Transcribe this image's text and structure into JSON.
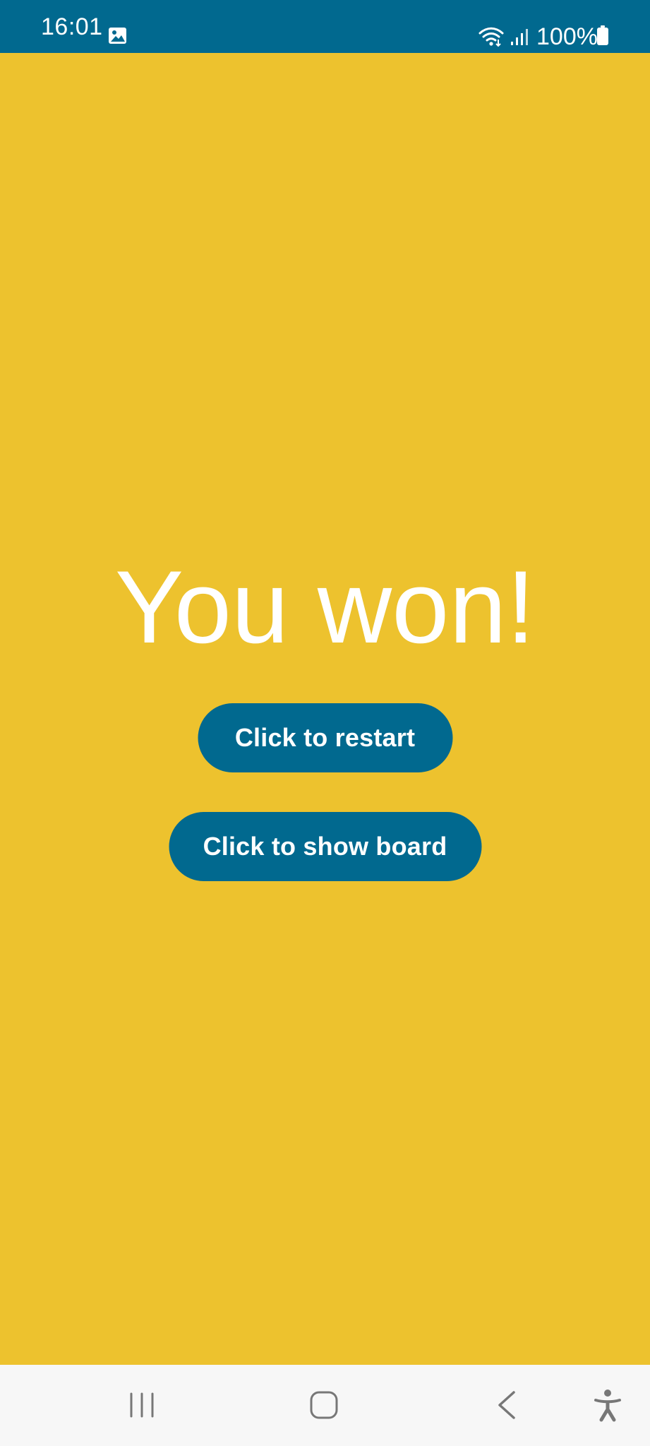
{
  "status_bar": {
    "time": "16:01",
    "battery": "100%",
    "icons": {
      "gallery": "gallery-icon",
      "wifi": "wifi-icon",
      "signal": "signal-icon",
      "battery": "battery-icon"
    }
  },
  "game_over": {
    "title": "You won!",
    "restart_label": "Click to restart",
    "show_board_label": "Click to show board"
  },
  "navigation_bar": {
    "recent_icon": "recent-apps-icon",
    "home_icon": "home-icon",
    "back_icon": "back-icon",
    "accessibility_icon": "accessibility-icon"
  },
  "colors": {
    "background": "#EDC22E",
    "status_bar": "#01698F",
    "button": "#01698F",
    "text": "#FFFFFF",
    "nav_bar": "#F7F7F7",
    "nav_icons": "#777777"
  }
}
